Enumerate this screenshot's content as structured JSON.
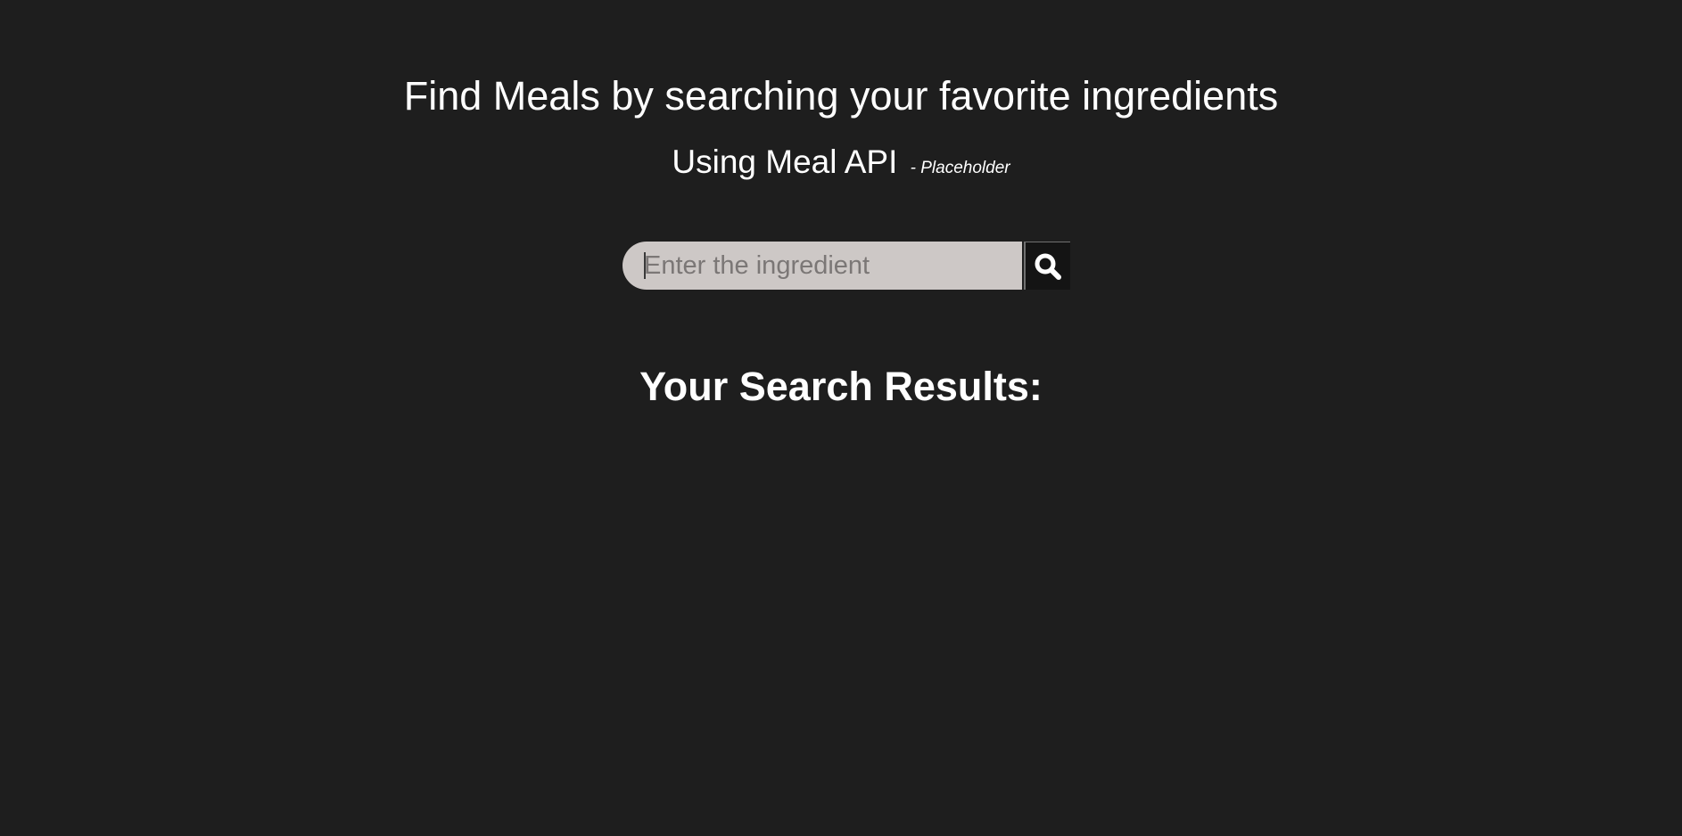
{
  "header": {
    "title": "Find Meals by searching your favorite ingredients",
    "subtitle": "Using Meal API",
    "subtitle_note": "- Placeholder"
  },
  "search": {
    "placeholder": "Enter the ingredient",
    "value": "",
    "button_icon": "search-icon"
  },
  "results": {
    "heading": "Your Search Results:",
    "items": []
  },
  "colors": {
    "background": "#1e1e1e",
    "text": "#ffffff",
    "input_background": "#cdc8c6",
    "placeholder": "#7b7776",
    "button_background": "#141414"
  }
}
